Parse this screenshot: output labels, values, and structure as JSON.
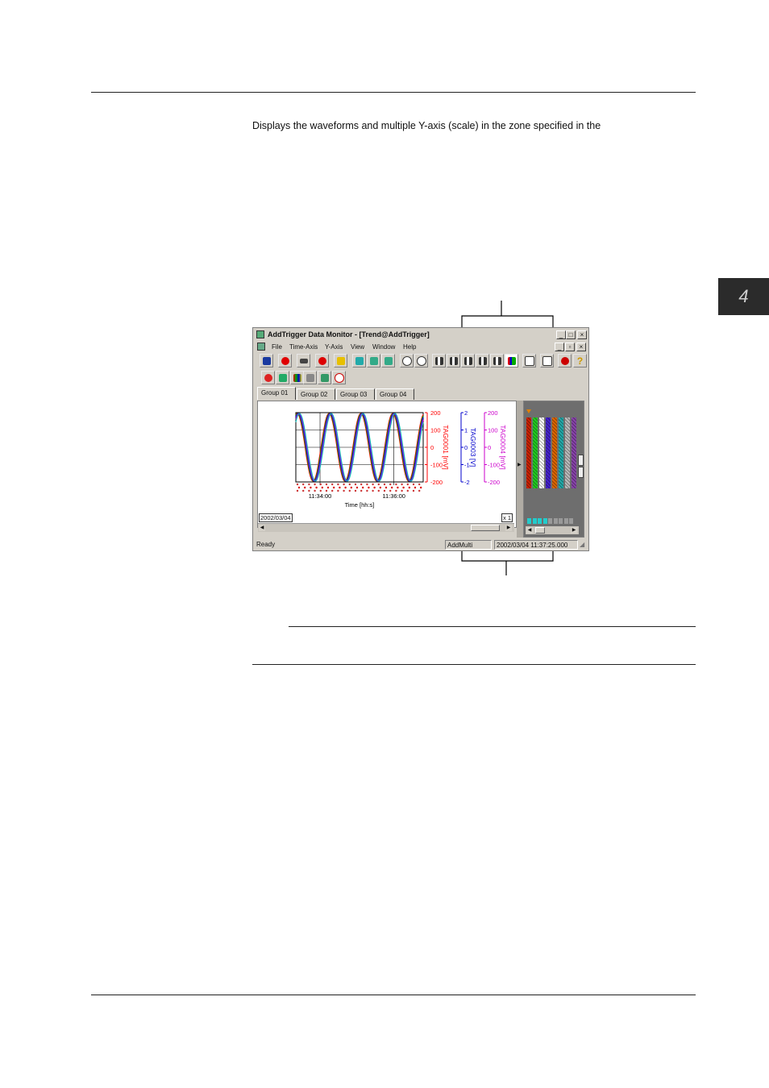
{
  "intro_text": "Displays the waveforms and multiple Y-axis (scale) in the zone specified in the",
  "chapter_tab": "4",
  "window": {
    "title": "AddTrigger Data Monitor - [Trend@AddTrigger]",
    "menu": [
      "File",
      "Time-Axis",
      "Y-Axis",
      "View",
      "Window",
      "Help"
    ],
    "tabs": [
      "Group 01",
      "Group 02",
      "Group 03",
      "Group 04"
    ],
    "date_box": "2002/03/04",
    "x1_box": "x 1",
    "status": {
      "ready": "Ready",
      "mode": "AddMulti",
      "time": "2002/03/04 11:37:25.000"
    }
  },
  "chart_data": {
    "type": "line",
    "xlabel": "Time [hh:s]",
    "x_ticks": [
      "11:34:00",
      "11:36:00"
    ],
    "series": [
      {
        "name": "TAG0001 [mV]",
        "color": "#ff0000",
        "ticks": [
          "200",
          "100",
          "0",
          "-100",
          "-200"
        ]
      },
      {
        "name": "TAG0003 [V]",
        "color": "#0000cc",
        "ticks": [
          "2",
          "1",
          "0",
          "-1",
          "-2"
        ]
      },
      {
        "name": "TAG0004 [mV]",
        "color": "#cc00cc",
        "ticks": [
          "200",
          "100",
          "0",
          "-100",
          "-200"
        ]
      }
    ],
    "waves": {
      "cycles": 4,
      "colors": [
        "#ff0000",
        "#00aa00",
        "#0000ff",
        "#cc00cc",
        "#00bbbb"
      ]
    },
    "grid": true
  },
  "colors": {
    "bars": [
      "#cc2200",
      "#22cc22",
      "#ffffff",
      "#4422cc",
      "#dd6600",
      "#22aaaa",
      "#bbbbbb",
      "#8844aa"
    ]
  }
}
